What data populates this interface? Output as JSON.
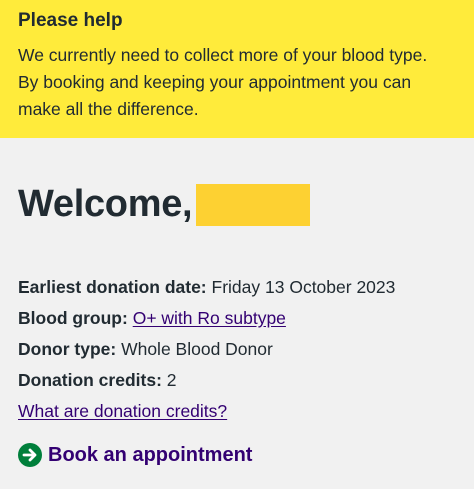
{
  "banner": {
    "title": "Please help",
    "line1": "We currently need to collect more of your blood type.",
    "line2": "By booking and keeping your appointment you can",
    "line3": "make all the difference."
  },
  "welcome": {
    "text": "Welcome,"
  },
  "details": {
    "earliest_label": "Earliest donation date:",
    "earliest_value": "Friday 13 October 2023",
    "blood_group_label": "Blood group:",
    "blood_group_value": "O+ with Ro subtype",
    "donor_type_label": "Donor type:",
    "donor_type_value": "Whole Blood Donor",
    "credits_label": "Donation credits:",
    "credits_value": "2",
    "credits_link": "What are donation credits?"
  },
  "actions": {
    "book_label": "Book an appointment",
    "book_icon": "arrow-right-circle-icon"
  },
  "colors": {
    "banner_bg": "#ffeb3b",
    "page_bg": "#f1f1f1",
    "link": "#330072",
    "icon_green": "#007f3b",
    "redaction": "#fdd132"
  }
}
